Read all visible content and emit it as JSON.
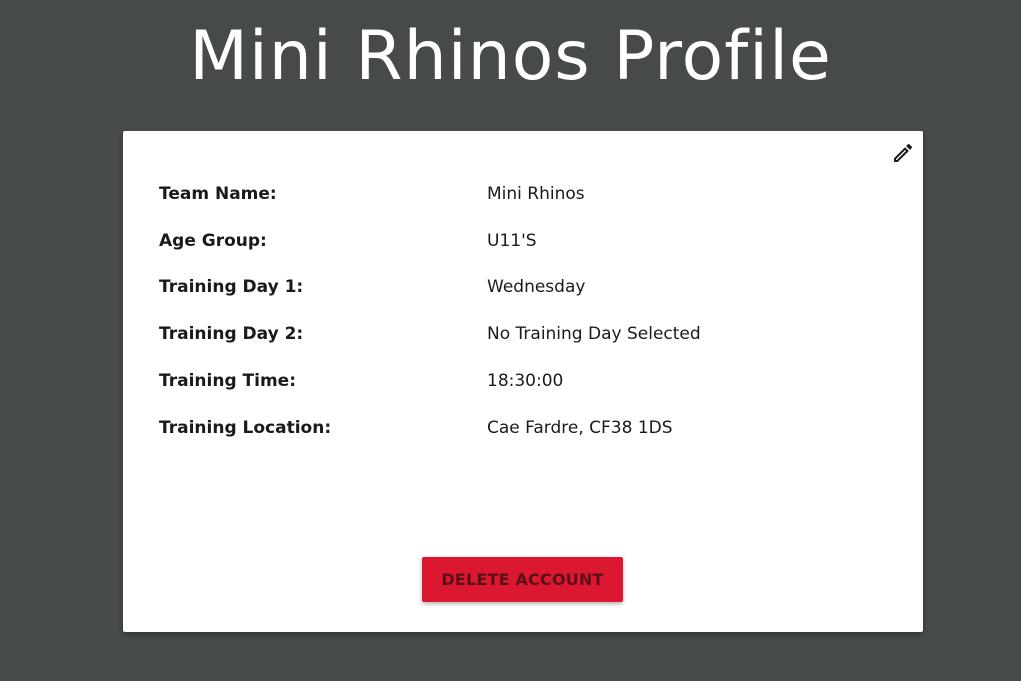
{
  "page": {
    "title": "Mini Rhinos Profile",
    "background_color": "#464a4a"
  },
  "profile": {
    "edit_icon": "pencil-icon",
    "fields": [
      {
        "label": "Team Name:",
        "value": "Mini Rhinos"
      },
      {
        "label": "Age Group:",
        "value": "U11'S"
      },
      {
        "label": "Training Day 1:",
        "value": "Wednesday"
      },
      {
        "label": "Training Day 2:",
        "value": "No Training Day Selected"
      },
      {
        "label": "Training Time:",
        "value": "18:30:00"
      },
      {
        "label": "Training Location:",
        "value": "Cae Fardre, CF38 1DS"
      }
    ],
    "delete_label": "DELETE ACCOUNT",
    "delete_color": "#dc1830"
  }
}
